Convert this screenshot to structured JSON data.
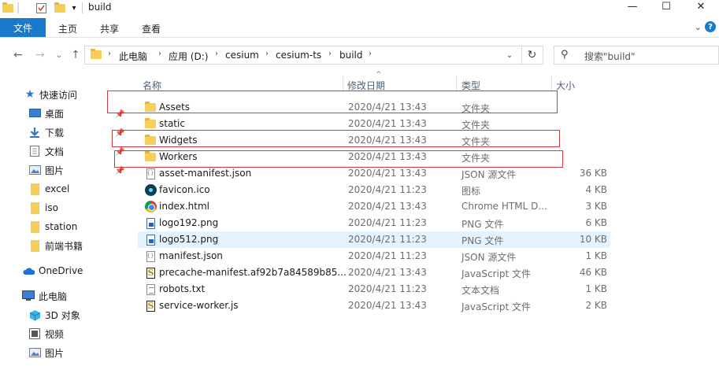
{
  "window": {
    "title": "build",
    "minimize_glyph": "—",
    "maximize_glyph": "☐",
    "close_glyph": "✕"
  },
  "quick_access_toolbar": {
    "dropdown_glyph": "▾"
  },
  "ribbon": {
    "file_tab": "文件",
    "tabs": [
      "主页",
      "共享",
      "查看"
    ],
    "expand_glyph": "⌄",
    "help_glyph": "?"
  },
  "nav": {
    "back_glyph": "←",
    "forward_glyph": "→",
    "recent_glyph": "⌄",
    "up_glyph": "↑"
  },
  "address": {
    "chevron": "›",
    "crumbs": [
      "此电脑",
      "应用 (D:)",
      "cesium",
      "cesium-ts",
      "build"
    ],
    "dropdown_glyph": "⌄",
    "refresh_glyph": "↻"
  },
  "search": {
    "placeholder": "搜索\"build\"",
    "icon_glyph": "⚲"
  },
  "columns": {
    "name": "名称",
    "date": "修改日期",
    "type": "类型",
    "size": "大小",
    "sort_glyph": "^"
  },
  "sidebar": {
    "quick_access": "快速访问",
    "items": [
      {
        "label": "桌面",
        "icon": "desktop-icon"
      },
      {
        "label": "下载",
        "icon": "download-icon"
      },
      {
        "label": "文档",
        "icon": "document-icon"
      },
      {
        "label": "图片",
        "icon": "picture-icon"
      },
      {
        "label": "excel",
        "icon": "folder-icon"
      },
      {
        "label": "iso",
        "icon": "folder-icon"
      },
      {
        "label": "station",
        "icon": "folder-icon"
      },
      {
        "label": "前端书籍",
        "icon": "folder-icon"
      }
    ],
    "onedrive": "OneDrive",
    "this_pc": "此电脑",
    "pc_items": [
      {
        "label": "3D 对象",
        "icon": "3d-objects-icon"
      },
      {
        "label": "视频",
        "icon": "video-icon"
      },
      {
        "label": "图片",
        "icon": "picture-icon"
      }
    ],
    "pin_glyph": "📌"
  },
  "files": [
    {
      "name": "Assets",
      "date": "2020/4/21 13:43",
      "type": "文件夹",
      "size": "",
      "icon": "folder"
    },
    {
      "name": "static",
      "date": "2020/4/21 13:43",
      "type": "文件夹",
      "size": "",
      "icon": "folder"
    },
    {
      "name": "Widgets",
      "date": "2020/4/21 13:43",
      "type": "文件夹",
      "size": "",
      "icon": "folder"
    },
    {
      "name": "Workers",
      "date": "2020/4/21 13:43",
      "type": "文件夹",
      "size": "",
      "icon": "folder"
    },
    {
      "name": "asset-manifest.json",
      "date": "2020/4/21 13:43",
      "type": "JSON 源文件",
      "size": "36 KB",
      "icon": "json"
    },
    {
      "name": "favicon.ico",
      "date": "2020/4/21 11:23",
      "type": "图标",
      "size": "4 KB",
      "icon": "react"
    },
    {
      "name": "index.html",
      "date": "2020/4/21 13:43",
      "type": "Chrome HTML D...",
      "size": "3 KB",
      "icon": "chrome"
    },
    {
      "name": "logo192.png",
      "date": "2020/4/21 11:23",
      "type": "PNG 文件",
      "size": "6 KB",
      "icon": "img"
    },
    {
      "name": "logo512.png",
      "date": "2020/4/21 11:23",
      "type": "PNG 文件",
      "size": "10 KB",
      "icon": "img"
    },
    {
      "name": "manifest.json",
      "date": "2020/4/21 11:23",
      "type": "JSON 源文件",
      "size": "1 KB",
      "icon": "json"
    },
    {
      "name": "precache-manifest.af92b7a84589b85...",
      "date": "2020/4/21 13:43",
      "type": "JavaScript 文件",
      "size": "46 KB",
      "icon": "js"
    },
    {
      "name": "robots.txt",
      "date": "2020/4/21 11:23",
      "type": "文本文档",
      "size": "1 KB",
      "icon": "txt"
    },
    {
      "name": "service-worker.js",
      "date": "2020/4/21 13:43",
      "type": "JavaScript 文件",
      "size": "2 KB",
      "icon": "js"
    }
  ],
  "hovered_file_index": 8,
  "highlighted_file_names": [
    "Assets",
    "Widgets",
    "Workers"
  ],
  "colors": {
    "accent": "#1979ca",
    "highlight_box": "#d03a3a",
    "hover_row": "#e5f3ff",
    "folder": "#f6ce5a"
  }
}
